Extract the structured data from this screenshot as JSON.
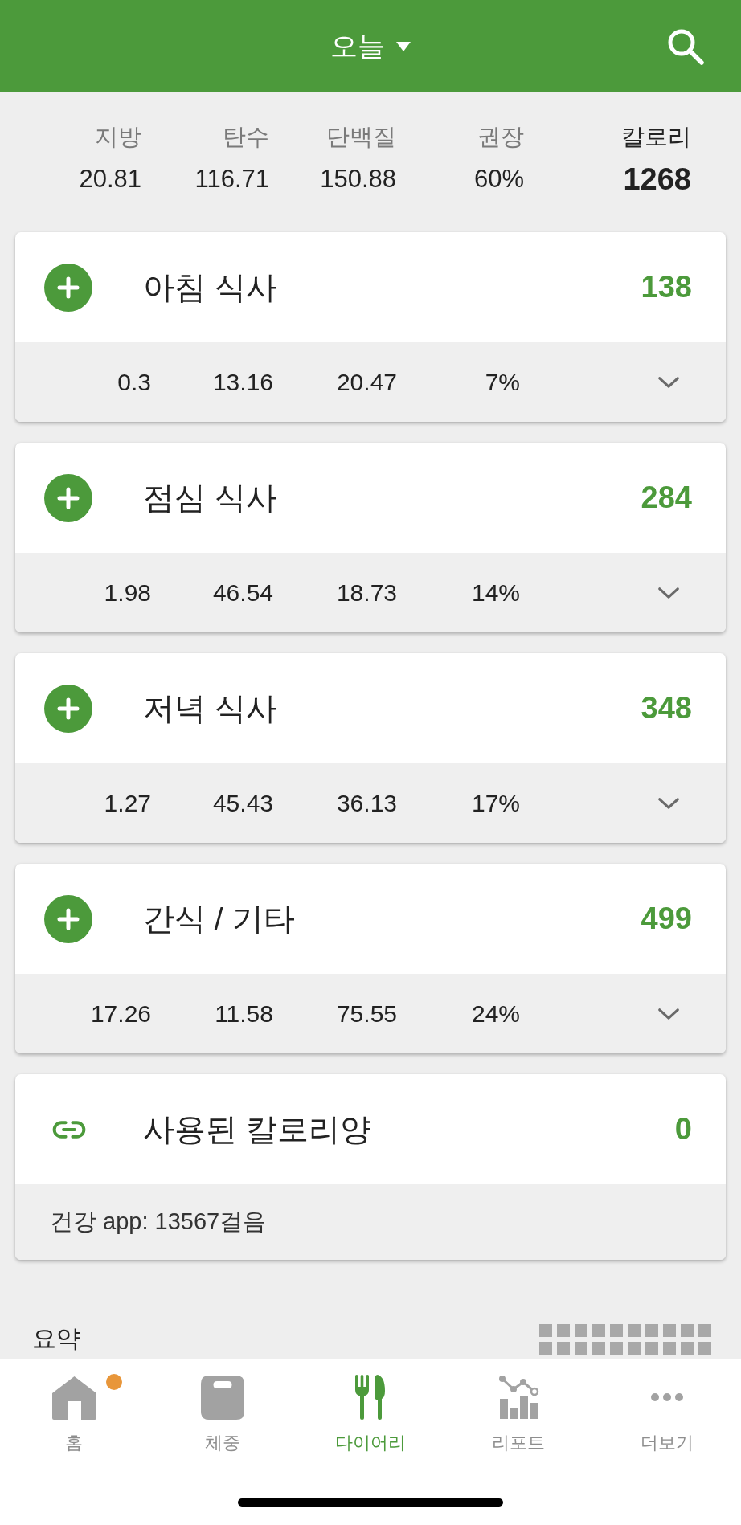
{
  "header": {
    "title": "오늘"
  },
  "summary": {
    "columns": [
      {
        "kind": "macro",
        "label": "지방",
        "value": "20.81"
      },
      {
        "kind": "macro",
        "label": "탄수",
        "value": "116.71"
      },
      {
        "kind": "macro",
        "label": "단백질",
        "value": "150.88"
      },
      {
        "kind": "macro",
        "label": "권장",
        "value": "60%"
      },
      {
        "kind": "total",
        "label": "칼로리",
        "value": "1268"
      }
    ]
  },
  "meals": [
    {
      "title": "아침 식사",
      "calories": "138",
      "values": [
        "0.3",
        "13.16",
        "20.47",
        "7%"
      ],
      "expanded": false
    },
    {
      "title": "점심 식사",
      "calories": "284",
      "values": [
        "1.98",
        "46.54",
        "18.73",
        "14%"
      ],
      "expanded": false
    },
    {
      "title": "저녁 식사",
      "calories": "348",
      "values": [
        "1.27",
        "45.43",
        "36.13",
        "17%"
      ],
      "expanded": false
    },
    {
      "title": "간식 / 기타",
      "calories": "499",
      "values": [
        "17.26",
        "11.58",
        "75.55",
        "24%"
      ],
      "expanded": false
    }
  ],
  "activity": {
    "title": "사용된 칼로리양",
    "calories": "0",
    "note": "건강 app: 13567걸음"
  },
  "section": {
    "title": "요약"
  },
  "tab_bar": [
    {
      "kind": "home",
      "label": "홈",
      "selected": false,
      "badge": true
    },
    {
      "kind": "scale",
      "label": "체중",
      "selected": false,
      "badge": false
    },
    {
      "kind": "diary",
      "label": "다이어리",
      "selected": true,
      "badge": false
    },
    {
      "kind": "report",
      "label": "리포트",
      "selected": false,
      "badge": false
    },
    {
      "kind": "more",
      "label": "더보기",
      "selected": false,
      "badge": false
    }
  ]
}
